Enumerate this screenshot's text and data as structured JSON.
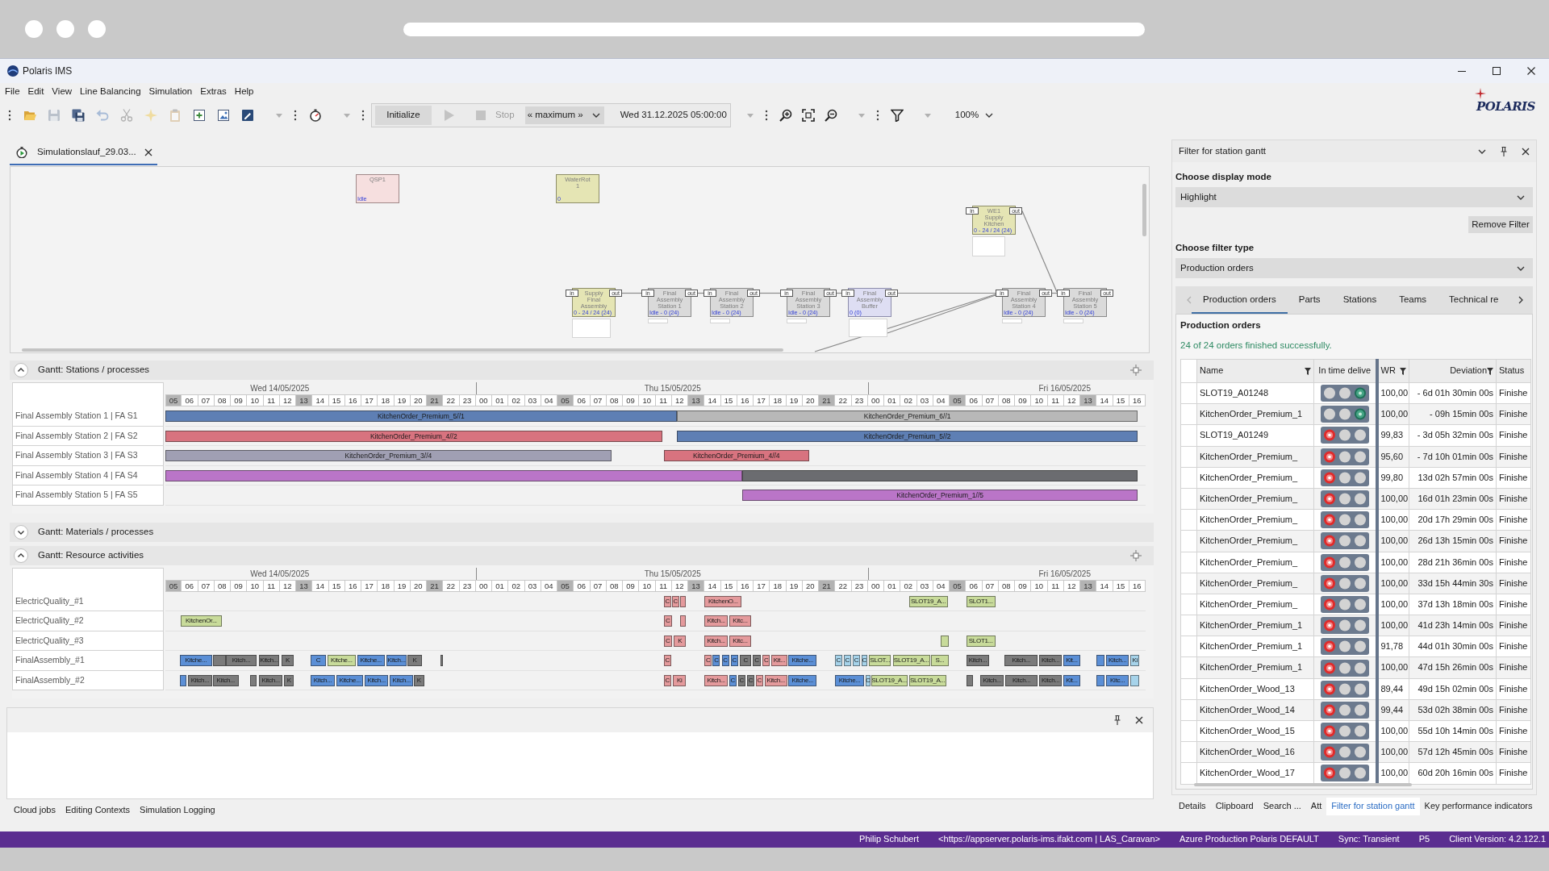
{
  "window": {
    "title": "Polaris IMS"
  },
  "menu": [
    "File",
    "Edit",
    "View",
    "Line Balancing",
    "Simulation",
    "Extras",
    "Help"
  ],
  "toolbar": [
    {
      "framed": false,
      "items": [
        {
          "kind": "grip",
          "disabled": false
        },
        {
          "kind": "open",
          "disabled": false
        },
        {
          "kind": "save",
          "disabled": true
        },
        {
          "kind": "save_all",
          "disabled": false
        },
        {
          "kind": "undo",
          "disabled": true
        },
        {
          "kind": "cut",
          "disabled": true
        },
        {
          "kind": "wand",
          "disabled": true
        },
        {
          "kind": "paste",
          "disabled": true
        },
        {
          "kind": "add_doc",
          "disabled": false
        },
        {
          "kind": "picture",
          "disabled": false
        },
        {
          "kind": "script",
          "disabled": false
        },
        {
          "kind": "caret",
          "disabled": true
        },
        {
          "kind": "grip",
          "disabled": false
        },
        {
          "kind": "stopwatch",
          "disabled": false
        },
        {
          "kind": "caret",
          "disabled": true
        },
        {
          "kind": "grip",
          "disabled": false
        }
      ]
    },
    {
      "framed": true,
      "items": [
        {
          "kind": "button",
          "label": "Initialize",
          "disabled": false
        },
        {
          "kind": "play",
          "disabled": true
        },
        {
          "kind": "stop",
          "label": "Stop",
          "disabled": true
        },
        {
          "kind": "select",
          "value": "« maximum »",
          "disabled": false
        },
        {
          "kind": "time",
          "label": "Wed 31.12.2025 05:00:00",
          "disabled": false
        }
      ]
    },
    {
      "framed": false,
      "items": [
        {
          "kind": "caret",
          "disabled": true
        },
        {
          "kind": "grip",
          "disabled": false
        },
        {
          "kind": "zoom_in",
          "disabled": false
        },
        {
          "kind": "fit",
          "disabled": false
        },
        {
          "kind": "zoom_out",
          "disabled": false
        },
        {
          "kind": "caret",
          "disabled": true
        },
        {
          "kind": "grip",
          "disabled": false
        },
        {
          "kind": "filter",
          "disabled": false
        },
        {
          "kind": "caret",
          "disabled": true
        },
        {
          "kind": "zoom",
          "value": "100%",
          "disabled": false
        }
      ]
    }
  ],
  "logo": "POLARIS",
  "document_tabs": [
    {
      "label": "Simulationslauf_29.03...",
      "selected": true
    }
  ],
  "diagram": {
    "nodes": [
      {
        "kind": "source",
        "title": "QSP1",
        "status": "Idle"
      },
      {
        "kind": "supply",
        "title": "WaterRot 1",
        "status": "0"
      },
      {
        "kind": "supply",
        "title": "WE1 Supply Kitchen",
        "status": "0 - 24 / 24 (24)",
        "in_port": "in",
        "out_port": "out"
      },
      {
        "kind": "supply",
        "title": "Supply Final Assembly",
        "status": "0 - 24 / 24 (24)",
        "in_port": "in",
        "out_port": "out"
      },
      {
        "kind": "station",
        "title": "Final Assembly Station 1",
        "status": "Idle - 0 (24)",
        "in_port": "in",
        "out_port": "out"
      },
      {
        "kind": "station",
        "title": "Final Assembly Station 2",
        "status": "Idle - 0 (24)",
        "in_port": "in",
        "out_port": "out"
      },
      {
        "kind": "station",
        "title": "Final Assembly Station 3",
        "status": "Idle - 0 (24)",
        "in_port": "in",
        "out_port": "out"
      },
      {
        "kind": "buffer",
        "title": "Final Assembly Buffer",
        "status": "0 (0)",
        "in_port": "in",
        "out_port": "out"
      },
      {
        "kind": "station",
        "title": "Final Assembly Station 4",
        "status": "Idle - 0 (24)",
        "in_port": "in",
        "out_port": "out"
      },
      {
        "kind": "station",
        "title": "Final Assembly Station 5",
        "status": "Idle - 0 (24)",
        "in_port": "in",
        "out_port": "out"
      }
    ]
  },
  "gantt_sections": [
    {
      "title": "Gantt: Stations / processes",
      "expanded": true,
      "days": [
        {
          "label": "Wed 14/05/2025",
          "hours": [
            {
              "label": "05",
              "shaded": true
            },
            {
              "label": "06",
              "shaded": false
            },
            {
              "label": "07",
              "shaded": false
            },
            {
              "label": "08",
              "shaded": false
            },
            {
              "label": "09",
              "shaded": false
            },
            {
              "label": "10",
              "shaded": false
            },
            {
              "label": "11",
              "shaded": false
            },
            {
              "label": "12",
              "shaded": false
            },
            {
              "label": "13",
              "shaded": true
            },
            {
              "label": "14",
              "shaded": false
            },
            {
              "label": "15",
              "shaded": false
            },
            {
              "label": "16",
              "shaded": false
            },
            {
              "label": "17",
              "shaded": false
            },
            {
              "label": "18",
              "shaded": false
            },
            {
              "label": "19",
              "shaded": false
            },
            {
              "label": "20",
              "shaded": false
            },
            {
              "label": "21",
              "shaded": true
            },
            {
              "label": "22",
              "shaded": false
            },
            {
              "label": "23",
              "shaded": false
            }
          ]
        },
        {
          "label": "Thu 15/05/2025",
          "hours": [
            {
              "label": "00",
              "shaded": false
            },
            {
              "label": "01",
              "shaded": false
            },
            {
              "label": "02",
              "shaded": false
            },
            {
              "label": "03",
              "shaded": false
            },
            {
              "label": "04",
              "shaded": false
            },
            {
              "label": "05",
              "shaded": true
            },
            {
              "label": "06",
              "shaded": false
            },
            {
              "label": "07",
              "shaded": false
            },
            {
              "label": "08",
              "shaded": false
            },
            {
              "label": "09",
              "shaded": false
            },
            {
              "label": "10",
              "shaded": false
            },
            {
              "label": "11",
              "shaded": false
            },
            {
              "label": "12",
              "shaded": false
            },
            {
              "label": "13",
              "shaded": true
            },
            {
              "label": "14",
              "shaded": false
            },
            {
              "label": "15",
              "shaded": false
            },
            {
              "label": "16",
              "shaded": false
            },
            {
              "label": "17",
              "shaded": false
            },
            {
              "label": "18",
              "shaded": false
            },
            {
              "label": "19",
              "shaded": false
            },
            {
              "label": "20",
              "shaded": false
            },
            {
              "label": "21",
              "shaded": true
            },
            {
              "label": "22",
              "shaded": false
            },
            {
              "label": "23",
              "shaded": false
            }
          ]
        },
        {
          "label": "Fri 16/05/2025",
          "hours": [
            {
              "label": "00",
              "shaded": false
            },
            {
              "label": "01",
              "shaded": false
            },
            {
              "label": "02",
              "shaded": false
            },
            {
              "label": "03",
              "shaded": false
            },
            {
              "label": "04",
              "shaded": false
            },
            {
              "label": "05",
              "shaded": true
            },
            {
              "label": "06",
              "shaded": false
            },
            {
              "label": "07",
              "shaded": false
            },
            {
              "label": "08",
              "shaded": false
            },
            {
              "label": "09",
              "shaded": false
            },
            {
              "label": "10",
              "shaded": false
            },
            {
              "label": "11",
              "shaded": false
            },
            {
              "label": "12",
              "shaded": false
            },
            {
              "label": "13",
              "shaded": true
            },
            {
              "label": "14",
              "shaded": false
            },
            {
              "label": "15",
              "shaded": false
            },
            {
              "label": "16",
              "shaded": false
            }
          ]
        }
      ],
      "rows": [
        {
          "label": "Final Assembly Station 1 | FA S1",
          "bars": [
            {
              "label": "KitchenOrder_Premium_5//1",
              "color": "#5e7fb4"
            },
            {
              "label": "KitchenOrder_Premium_6//1",
              "color": "#b8b8b8"
            }
          ]
        },
        {
          "label": "Final Assembly Station 2 | FA S2",
          "bars": [
            {
              "label": "KitchenOrder_Premium_4//2",
              "color": "#d8737f"
            },
            {
              "label": "KitchenOrder_Premium_5//2",
              "color": "#5e7fb4"
            }
          ]
        },
        {
          "label": "Final Assembly Station 3 | FA S3",
          "bars": [
            {
              "label": "KitchenOrder_Premium_3//4",
              "color": "#a09fb3"
            },
            {
              "label": "KitchenOrder_Premium_4//4",
              "color": "#d8737f"
            }
          ]
        },
        {
          "label": "Final Assembly Station 4 | FA S4",
          "bars": [
            {
              "color": "#ba75c8"
            },
            {
              "color": "#6b6c70"
            }
          ]
        },
        {
          "label": "Final Assembly Station 5 | FA S5",
          "bars": [
            {
              "label": "KitchenOrder_Premium_1//5",
              "color": "#ba75c8"
            }
          ]
        }
      ]
    },
    {
      "title": "Gantt: Materials / processes",
      "expanded": false
    },
    {
      "title": "Gantt: Resource activities",
      "expanded": true,
      "days": [
        {
          "label": "Wed 14/05/2025",
          "hours": [
            {
              "label": "05",
              "shaded": true
            },
            {
              "label": "06",
              "shaded": false
            },
            {
              "label": "07",
              "shaded": false
            },
            {
              "label": "08",
              "shaded": false
            },
            {
              "label": "09",
              "shaded": false
            },
            {
              "label": "10",
              "shaded": false
            },
            {
              "label": "11",
              "shaded": false
            },
            {
              "label": "12",
              "shaded": false
            },
            {
              "label": "13",
              "shaded": true
            },
            {
              "label": "14",
              "shaded": false
            },
            {
              "label": "15",
              "shaded": false
            },
            {
              "label": "16",
              "shaded": false
            },
            {
              "label": "17",
              "shaded": false
            },
            {
              "label": "18",
              "shaded": false
            },
            {
              "label": "19",
              "shaded": false
            },
            {
              "label": "20",
              "shaded": false
            },
            {
              "label": "21",
              "shaded": true
            },
            {
              "label": "22",
              "shaded": false
            },
            {
              "label": "23",
              "shaded": false
            }
          ]
        },
        {
          "label": "Thu 15/05/2025",
          "hours": [
            {
              "label": "00",
              "shaded": false
            },
            {
              "label": "01",
              "shaded": false
            },
            {
              "label": "02",
              "shaded": false
            },
            {
              "label": "03",
              "shaded": false
            },
            {
              "label": "04",
              "shaded": false
            },
            {
              "label": "05",
              "shaded": true
            },
            {
              "label": "06",
              "shaded": false
            },
            {
              "label": "07",
              "shaded": false
            },
            {
              "label": "08",
              "shaded": false
            },
            {
              "label": "09",
              "shaded": false
            },
            {
              "label": "10",
              "shaded": false
            },
            {
              "label": "11",
              "shaded": false
            },
            {
              "label": "12",
              "shaded": false
            },
            {
              "label": "13",
              "shaded": true
            },
            {
              "label": "14",
              "shaded": false
            },
            {
              "label": "15",
              "shaded": false
            },
            {
              "label": "16",
              "shaded": false
            },
            {
              "label": "17",
              "shaded": false
            },
            {
              "label": "18",
              "shaded": false
            },
            {
              "label": "19",
              "shaded": false
            },
            {
              "label": "20",
              "shaded": false
            },
            {
              "label": "21",
              "shaded": true
            },
            {
              "label": "22",
              "shaded": false
            },
            {
              "label": "23",
              "shaded": false
            }
          ]
        },
        {
          "label": "Fri 16/05/2025",
          "hours": [
            {
              "label": "00",
              "shaded": false
            },
            {
              "label": "01",
              "shaded": false
            },
            {
              "label": "02",
              "shaded": false
            },
            {
              "label": "03",
              "shaded": false
            },
            {
              "label": "04",
              "shaded": false
            },
            {
              "label": "05",
              "shaded": true
            },
            {
              "label": "06",
              "shaded": false
            },
            {
              "label": "07",
              "shaded": false
            },
            {
              "label": "08",
              "shaded": false
            },
            {
              "label": "09",
              "shaded": false
            },
            {
              "label": "10",
              "shaded": false
            },
            {
              "label": "11",
              "shaded": false
            },
            {
              "label": "12",
              "shaded": false
            },
            {
              "label": "13",
              "shaded": true
            },
            {
              "label": "14",
              "shaded": false
            },
            {
              "label": "15",
              "shaded": false
            },
            {
              "label": "16",
              "shaded": false
            }
          ]
        }
      ],
      "rows": [
        {
          "label": "ElectricQuality_#1",
          "bars": [
            {
              "label": "C",
              "color": "#e49a9c"
            },
            {
              "label": "C",
              "color": "#e49a9c"
            },
            {
              "color": "#e49a9c"
            },
            {
              "label": "KitchenO...",
              "color": "#e49a9c"
            },
            {
              "label": "SLOT19_A...",
              "color": "#c8db9a"
            },
            {
              "label": "SLOT1...",
              "color": "#c8db9a"
            }
          ]
        },
        {
          "label": "ElectricQuality_#2",
          "bars": [
            {
              "label": "KitchenOr...",
              "color": "#c8db9a"
            },
            {
              "label": "C",
              "color": "#e49a9c"
            },
            {
              "color": "#e49a9c"
            },
            {
              "label": "Kitch...",
              "color": "#e49a9c"
            },
            {
              "label": "Kitc...",
              "color": "#e49a9c"
            }
          ]
        },
        {
          "label": "ElectricQuality_#3",
          "bars": [
            {
              "label": "C",
              "color": "#e49a9c"
            },
            {
              "label": "K",
              "color": "#e49a9c"
            },
            {
              "label": "Kitch...",
              "color": "#e49a9c"
            },
            {
              "label": "Kitc...",
              "color": "#e49a9c"
            },
            {
              "color": "#c8db9a"
            },
            {
              "label": "SLOT1...",
              "color": "#c8db9a"
            }
          ]
        },
        {
          "label": "FinalAssembly_#1",
          "bars": [
            {
              "label": "Kitche...",
              "color": "#5b8fd6"
            },
            {
              "color": "#7b7b7b"
            },
            {
              "label": "Kitch...",
              "color": "#7b7b7b"
            },
            {
              "label": "Kitch...",
              "color": "#7b7b7b"
            },
            {
              "label": "K",
              "color": "#7b7b7b"
            },
            {
              "label": "C",
              "color": "#5b8fd6"
            },
            {
              "label": "Kitche...",
              "color": "#c8db9a"
            },
            {
              "label": "Kitche...",
              "color": "#5b8fd6"
            },
            {
              "label": "Kitch...",
              "color": "#5b8fd6"
            },
            {
              "label": "K",
              "color": "#7b7b7b"
            },
            {
              "color": "#7b7b7b"
            },
            {
              "label": "C",
              "color": "#e49a9c"
            },
            {
              "label": "C",
              "color": "#e49a9c"
            },
            {
              "label": "C",
              "color": "#5b8fd6"
            },
            {
              "label": "C",
              "color": "#5b8fd6"
            },
            {
              "label": "C",
              "color": "#5b8fd6"
            },
            {
              "label": "C",
              "color": "#7b7b7b"
            },
            {
              "label": "C",
              "color": "#7b7b7b"
            },
            {
              "label": "C",
              "color": "#e49a9c"
            },
            {
              "label": "Kit...",
              "color": "#e49a9c"
            },
            {
              "label": "Kitche...",
              "color": "#5b8fd6"
            },
            {
              "label": "C",
              "color": "#a6d3ea"
            },
            {
              "label": "C",
              "color": "#a6d3ea"
            },
            {
              "label": "C",
              "color": "#a6d3ea"
            },
            {
              "label": "C",
              "color": "#a6d3ea"
            },
            {
              "label": "SLOT...",
              "color": "#c8db9a"
            },
            {
              "label": "SLOT19_A...",
              "color": "#c8db9a"
            },
            {
              "label": "S...",
              "color": "#c8db9a"
            },
            {
              "label": "Kitch...",
              "color": "#7b7b7b"
            },
            {
              "label": "Kitch...",
              "color": "#7b7b7b"
            },
            {
              "label": "Kitch...",
              "color": "#7b7b7b"
            },
            {
              "label": "Kit...",
              "color": "#5b8fd6"
            },
            {
              "color": "#5b8fd6"
            },
            {
              "label": "Kitch...",
              "color": "#5b8fd6"
            },
            {
              "label": "Ki",
              "color": "#a6d3ea"
            }
          ]
        },
        {
          "label": "FinalAssembly_#2",
          "bars": [
            {
              "color": "#5b8fd6"
            },
            {
              "label": "Kitch...",
              "color": "#7b7b7b"
            },
            {
              "label": "Kitch...",
              "color": "#7b7b7b"
            },
            {
              "color": "#7b7b7b"
            },
            {
              "label": "Kitch...",
              "color": "#7b7b7b"
            },
            {
              "label": "K",
              "color": "#7b7b7b"
            },
            {
              "label": "Kitch...",
              "color": "#5b8fd6"
            },
            {
              "label": "Kitche...",
              "color": "#5b8fd6"
            },
            {
              "label": "Kitch...",
              "color": "#5b8fd6"
            },
            {
              "label": "Kitch...",
              "color": "#5b8fd6"
            },
            {
              "label": "K",
              "color": "#7b7b7b"
            },
            {
              "label": "C",
              "color": "#e49a9c"
            },
            {
              "label": "Ki",
              "color": "#e49a9c"
            },
            {
              "label": "Kitch...",
              "color": "#e49a9c"
            },
            {
              "label": "C",
              "color": "#5b8fd6"
            },
            {
              "label": "C",
              "color": "#7b7b7b"
            },
            {
              "label": "C",
              "color": "#7b7b7b"
            },
            {
              "label": "C",
              "color": "#e49a9c"
            },
            {
              "label": "Kitch...",
              "color": "#e49a9c"
            },
            {
              "label": "Kitche...",
              "color": "#5b8fd6"
            },
            {
              "label": "Kitche...",
              "color": "#5b8fd6"
            },
            {
              "label": "C",
              "color": "#a6d3ea"
            },
            {
              "label": "SLOT19_A...",
              "color": "#c8db9a"
            },
            {
              "label": "SLOT19_A...",
              "color": "#c8db9a"
            },
            {
              "color": "#7b7b7b"
            },
            {
              "label": "Kitch...",
              "color": "#7b7b7b"
            },
            {
              "label": "Kitch...",
              "color": "#7b7b7b"
            },
            {
              "label": "Kitch...",
              "color": "#7b7b7b"
            },
            {
              "label": "Kit...",
              "color": "#5b8fd6"
            },
            {
              "color": "#5b8fd6"
            },
            {
              "label": "Kitc...",
              "color": "#5b8fd6"
            },
            {
              "color": "#a6d3ea"
            }
          ]
        }
      ]
    }
  ],
  "bottom_tabs": [
    {
      "label": "Cloud jobs",
      "selected": false
    },
    {
      "label": "Editing Contexts",
      "selected": false
    },
    {
      "label": "Simulation Logging",
      "selected": false
    }
  ],
  "filter_panel": {
    "title": "Filter for station gantt",
    "display_mode": {
      "label": "Choose display mode",
      "value": "Highlight"
    },
    "remove_button": "Remove Filter",
    "filter_type": {
      "label": "Choose filter type",
      "value": "Production orders"
    },
    "tabs": [
      {
        "label": "Production orders",
        "selected": true
      },
      {
        "label": "Parts",
        "selected": false
      },
      {
        "label": "Stations",
        "selected": false
      },
      {
        "label": "Teams",
        "selected": false
      },
      {
        "label": "Technical re",
        "selected": false
      }
    ],
    "heading": "Production orders",
    "message": "24 of 24 orders finished successfully.",
    "columns": [
      {
        "label": "Name",
        "filter": true
      },
      {
        "label": "In time delive",
        "filter": false
      },
      {
        "label": "WR",
        "filter": true
      },
      {
        "label": "Deviation",
        "filter": true
      },
      {
        "label": "Status",
        "filter": false
      }
    ],
    "rows": [
      {
        "name": "SLOT19_A01248",
        "in_time": true,
        "wr": "100,00",
        "deviation": "- 6d 01h 30min 00s",
        "status": "Finishe"
      },
      {
        "name": "KitchenOrder_Premium_1",
        "in_time": true,
        "wr": "100,00",
        "deviation": "- 09h 15min 00s",
        "status": "Finishe"
      },
      {
        "name": "SLOT19_A01249",
        "in_time": false,
        "wr": "99,83",
        "deviation": "- 3d 05h 32min 00s",
        "status": "Finishe"
      },
      {
        "name": "KitchenOrder_Premium_",
        "in_time": false,
        "wr": "95,60",
        "deviation": "- 7d 10h 01min 00s",
        "status": "Finishe"
      },
      {
        "name": "KitchenOrder_Premium_",
        "in_time": false,
        "wr": "99,80",
        "deviation": "13d 02h 57min 00s",
        "status": "Finishe"
      },
      {
        "name": "KitchenOrder_Premium_",
        "in_time": false,
        "wr": "100,00",
        "deviation": "16d 01h 23min 00s",
        "status": "Finishe"
      },
      {
        "name": "KitchenOrder_Premium_",
        "in_time": false,
        "wr": "100,00",
        "deviation": "20d 17h 29min 00s",
        "status": "Finishe"
      },
      {
        "name": "KitchenOrder_Premium_",
        "in_time": false,
        "wr": "100,00",
        "deviation": "26d 13h 15min 00s",
        "status": "Finishe"
      },
      {
        "name": "KitchenOrder_Premium_",
        "in_time": false,
        "wr": "100,00",
        "deviation": "28d 21h 36min 00s",
        "status": "Finishe"
      },
      {
        "name": "KitchenOrder_Premium_",
        "in_time": false,
        "wr": "100,00",
        "deviation": "33d 15h 44min 30s",
        "status": "Finishe"
      },
      {
        "name": "KitchenOrder_Premium_",
        "in_time": false,
        "wr": "100,00",
        "deviation": "37d 13h 18min 00s",
        "status": "Finishe"
      },
      {
        "name": "KitchenOrder_Premium_1",
        "in_time": false,
        "wr": "100,00",
        "deviation": "41d 23h 14min 00s",
        "status": "Finishe"
      },
      {
        "name": "KitchenOrder_Premium_1",
        "in_time": false,
        "wr": "91,78",
        "deviation": "44d 01h 30min 00s",
        "status": "Finishe"
      },
      {
        "name": "KitchenOrder_Premium_1",
        "in_time": false,
        "wr": "100,00",
        "deviation": "47d 15h 26min 00s",
        "status": "Finishe"
      },
      {
        "name": "KitchenOrder_Wood_13",
        "in_time": false,
        "wr": "89,44",
        "deviation": "49d 15h 02min 00s",
        "status": "Finishe"
      },
      {
        "name": "KitchenOrder_Wood_14",
        "in_time": false,
        "wr": "99,44",
        "deviation": "53d 02h 38min 00s",
        "status": "Finishe"
      },
      {
        "name": "KitchenOrder_Wood_15",
        "in_time": false,
        "wr": "100,00",
        "deviation": "55d 10h 14min 00s",
        "status": "Finishe"
      },
      {
        "name": "KitchenOrder_Wood_16",
        "in_time": false,
        "wr": "100,00",
        "deviation": "57d 12h 45min 00s",
        "status": "Finishe"
      },
      {
        "name": "KitchenOrder_Wood_17",
        "in_time": false,
        "wr": "100,00",
        "deviation": "60d 20h 16min 00s",
        "status": "Finishe"
      }
    ]
  },
  "side_tabs": [
    {
      "label": "Details",
      "selected": false
    },
    {
      "label": "Clipboard",
      "selected": false
    },
    {
      "label": "Search ...",
      "selected": false
    },
    {
      "label": "Att",
      "selected": false
    },
    {
      "label": "Filter for station gantt",
      "selected": true
    },
    {
      "label": "Key performance indicators",
      "selected": false
    }
  ],
  "status_bar": [
    "Philip Schubert",
    "<https://appserver.polaris-ims.ifakt.com | LAS_Caravan>",
    "Azure Production Polaris DEFAULT",
    "Sync: Transient",
    "P5",
    "Client Version: 4.2.122.1"
  ]
}
